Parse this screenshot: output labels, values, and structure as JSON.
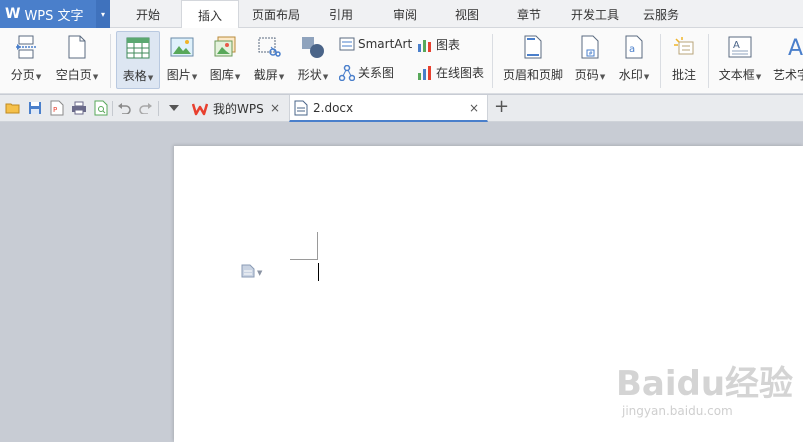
{
  "app": {
    "logo": "W",
    "name": "WPS 文字",
    "dropdown": "▾"
  },
  "menu_tabs": [
    "开始",
    "插入",
    "页面布局",
    "引用",
    "审阅",
    "视图",
    "章节",
    "开发工具",
    "云服务"
  ],
  "active_menu_tab": "插入",
  "ribbon": {
    "page_break": "分页",
    "blank_page": "空白页",
    "table": "表格",
    "picture": "图片",
    "gallery": "图库",
    "screenshot": "截屏",
    "shapes": "形状",
    "smartart": "SmartArt",
    "chart": "图表",
    "relationship": "关系图",
    "online_chart": "在线图表",
    "header_footer": "页眉和页脚",
    "page_number": "页码",
    "watermark": "水印",
    "comment": "批注",
    "text_box": "文本框",
    "word_art": "艺术字"
  },
  "doc_tabs": [
    {
      "label": "我的WPS",
      "close": "×"
    },
    {
      "label": "2.docx",
      "close": "×"
    }
  ],
  "new_tab": "+",
  "watermark": {
    "brand": "Baidu经验",
    "url": "jingyan.baidu.com"
  },
  "colors": {
    "accent": "#4a7fcb",
    "wps_red": "#e8402f"
  }
}
